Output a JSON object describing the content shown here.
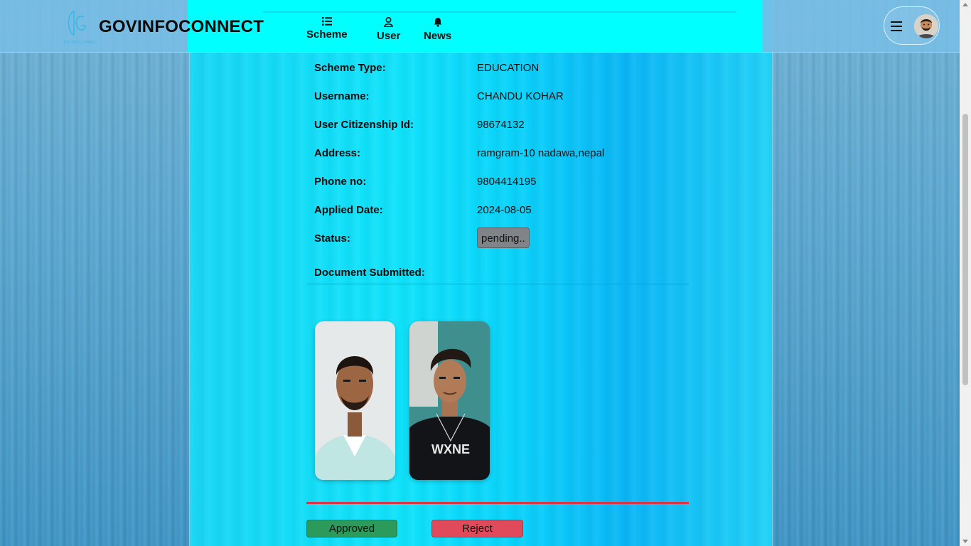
{
  "brand": {
    "name": "GOVINFOCONNECT"
  },
  "nav": {
    "items": [
      {
        "label": "Scheme",
        "icon": "list-icon"
      },
      {
        "label": "User",
        "icon": "user-icon"
      },
      {
        "label": "News",
        "icon": "bell-icon"
      }
    ]
  },
  "details": [
    {
      "label": "Scheme Type:",
      "value": "EDUCATION"
    },
    {
      "label": "Username:",
      "value": "CHANDU KOHAR"
    },
    {
      "label": "User Citizenship Id:",
      "value": "98674132"
    },
    {
      "label": "Address:",
      "value": "ramgram-10 nadawa,nepal"
    },
    {
      "label": "Phone no:",
      "value": "9804414195"
    },
    {
      "label": "Applied Date:",
      "value": "2024-08-05"
    }
  ],
  "status": {
    "label": "Status:",
    "value": "pending.."
  },
  "documents": {
    "title": "Document Submitted:",
    "shirt_text": "WXNE"
  },
  "actions": {
    "approve": "Approved",
    "reject": "Reject"
  },
  "colors": {
    "navbar_accent": "#00ffff",
    "approve": "#2b9a5a",
    "reject": "#e04a5a",
    "status_badge": "#808387"
  }
}
